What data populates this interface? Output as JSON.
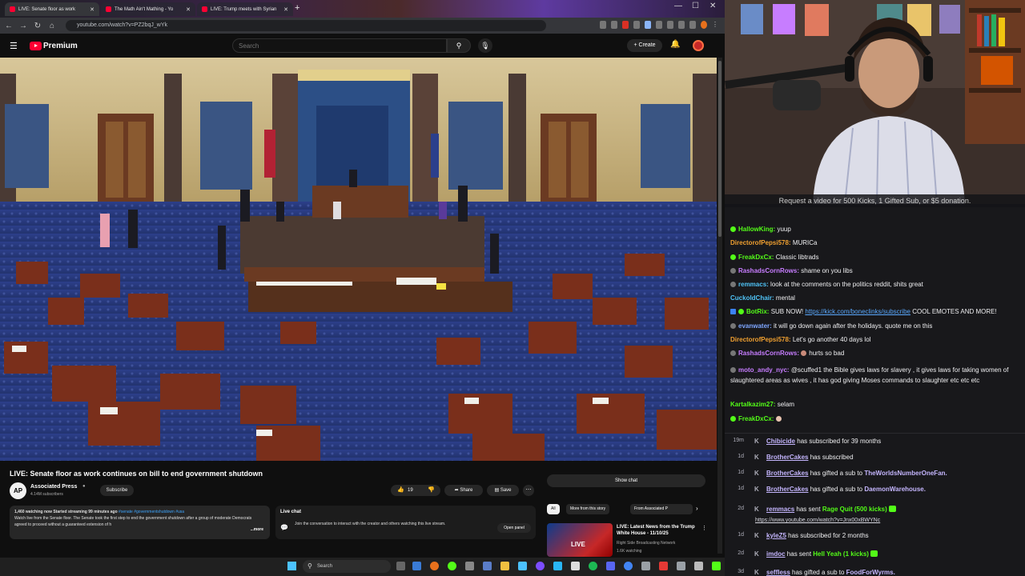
{
  "browser": {
    "tabs": [
      {
        "label": "LIVE: Senate floor as work"
      },
      {
        "label": "The Math Ain't Mathing - Yo"
      },
      {
        "label": "LIVE: Trump meets with Syrian"
      }
    ],
    "url": "youtube.com/watch?v=PZ2bqJ_wYk"
  },
  "yt": {
    "brand": "Premium",
    "search_placeholder": "Search",
    "create_label": "Create"
  },
  "video": {
    "title": "LIVE: Senate floor as work continues on bill to end government shutdown",
    "channel": "Associated Press",
    "channel_avatar_text": "AP",
    "subscribers": "4.14M subscribers",
    "subscribe_label": "Subscribe",
    "likes": "19",
    "share_label": "Share",
    "save_label": "Save",
    "show_chat_label": "Show chat",
    "description": {
      "stats": "1,460 watching now  Started streaming 99 minutes ago",
      "tags": "#senate #governmentshutdown #usa",
      "text": "Watch live from the Senate floor. The Senate took the first step to end the government shutdown after a group of moderate Democrats agreed to proceed without a guaranteed extension of h",
      "more": "...more"
    },
    "live_chat": {
      "title": "Live chat",
      "text": "Join the conversation to interact with the creator and others watching this live stream.",
      "open_panel": "Open panel"
    },
    "chips": [
      "All",
      "More from this story",
      "From Associated P"
    ],
    "recommendation": {
      "title": "LIVE: Latest News from the Trump White House - 11/10/25",
      "channel": "Right Side Broadcasting Network",
      "watching": "1.6K watching",
      "thumb_label": "LIVE"
    }
  },
  "taskbar": {
    "search": "Search"
  },
  "overlay": {
    "banner": "Request a video for 500 Kicks, 1 Gifted Sub, or $5 donation.",
    "chat": [
      {
        "user": "HallowKing:",
        "color": "#53fc18",
        "text": "yuup"
      },
      {
        "user": "DirectorofPepsi578:",
        "color": "#f0a030",
        "text": "MURICa"
      },
      {
        "user": "FreakDxCx:",
        "color": "#53fc18",
        "text": "Classic libtrads"
      },
      {
        "user": "RashadsCornRows:",
        "color": "#c77dff",
        "text": "shame on you libs"
      },
      {
        "user": "remmacs:",
        "color": "#4fc3f7",
        "text": "look at the comments on the politics reddit, shits great"
      },
      {
        "user": "CuckoldChair:",
        "color": "#4fc3f7",
        "text": "mental"
      },
      {
        "user": "BotRix:",
        "color": "#53fc18",
        "text": "SUB NOW!",
        "link": "https://kick.com/boneclinks/subscribe",
        "after": "COOL EMOTES AND MORE!"
      },
      {
        "user": "evanwater:",
        "color": "#7ea6ff",
        "text": "it will go down again after the holidays. quote me on this"
      },
      {
        "user": "DirectorofPepsi578:",
        "color": "#f0a030",
        "text": "Let's go another 40 days lol"
      },
      {
        "user": "RashadsCornRows:",
        "color": "#c77dff",
        "text": "hurts so bad"
      },
      {
        "user": "moto_andy_nyc:",
        "color": "#c77dff",
        "text": "@scuffed1 the Bible gives laws for slavery , it gives laws for taking women of slaughtered areas as wives , it has god giving Moses commands to slaughter etc etc etc"
      },
      {
        "user": "Kartalkazim27:",
        "color": "#53fc18",
        "text": "selam"
      },
      {
        "user": "FreakDxCx:",
        "color": "#53fc18",
        "text": ""
      }
    ],
    "events": [
      {
        "time": "19m",
        "name": "Chibicide",
        "text": "has subscribed for 39 months"
      },
      {
        "time": "1d",
        "name": "BrotherCakes",
        "text": "has subscribed"
      },
      {
        "time": "1d",
        "name": "BrotherCakes",
        "text": "has gifted a sub to",
        "target": "TheWorldsNumberOneFan."
      },
      {
        "time": "1d",
        "name": "BrotherCakes",
        "text": "has gifted a sub to",
        "target": "DaemonWarehouse."
      },
      {
        "time": "2d",
        "name": "remmacs",
        "text": "has sent",
        "green": "Rage Quit (500 kicks)",
        "link": "https://www.youtube.com/watch?v=Jnx00xBWYNc"
      },
      {
        "time": "1d",
        "name": "kyleZ5",
        "text": "has subscribed for 2 months"
      },
      {
        "time": "2d",
        "name": "imdoc",
        "text": "has sent",
        "green": "Hell Yeah (1 kicks)"
      },
      {
        "time": "3d",
        "name": "seffless",
        "text": "has gifted a sub to",
        "target": "FoodForWyrms."
      }
    ]
  }
}
